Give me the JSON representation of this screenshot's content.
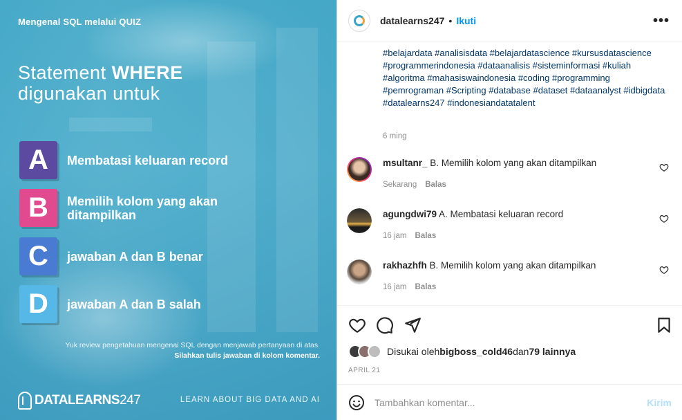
{
  "post_image": {
    "header": "Mengenal SQL melalui QUIZ",
    "question_line1_pre": "Statement ",
    "question_line1_bold": "WHERE",
    "question_line2": "digunakan untuk",
    "options": [
      {
        "letter": "A",
        "text": "Membatasi keluaran record",
        "color": "#5b4a9f"
      },
      {
        "letter": "B",
        "text": "Memilih kolom yang akan ditampilkan",
        "color": "#e24a8f"
      },
      {
        "letter": "C",
        "text": "jawaban A dan B benar",
        "color": "#4a7bd3"
      },
      {
        "letter": "D",
        "text": "jawaban A dan B salah",
        "color": "#55b8e6"
      }
    ],
    "footer_line1": "Yuk review pengetahuan mengenai SQL dengan menjawab pertanyaan di atas.",
    "footer_line2": "Silahkan tulis jawaban di kolom komentar.",
    "brand_bold": "DATA",
    "brand_mid": "LEARNS",
    "brand_num": "247",
    "tagline": "LEARN ABOUT BIG DATA AND AI"
  },
  "panel": {
    "username": "datalearns247",
    "dot": "•",
    "follow": "Ikuti",
    "more": "•••",
    "hashtags": "#belajardata #analisisdata #belajardatascience #kursusdatascience #programmerindonesia #dataanalisis #sisteminformasi #kuliah #algoritma #mahasiswaindonesia #coding #programming #pemrograman #Scripting #database #dataset #dataanalyst #idbigdata #datalearns247 #indonesiandatatalent",
    "post_time": "6 ming",
    "comments": [
      {
        "user": "msultanr_",
        "text": "B. Memilih kolom yang akan ditampilkan",
        "time": "Sekarang",
        "reply": "Balas"
      },
      {
        "user": "agungdwi79",
        "text": "A. Membatasi keluaran record",
        "time": "16 jam",
        "reply": "Balas"
      },
      {
        "user": "rakhazhfh",
        "text": "B. Memilih kolom yang akan ditampilkan",
        "time": "16 jam",
        "reply": "Balas"
      }
    ],
    "likes_prefix": "Disukai oleh ",
    "likes_user": "bigboss_cold46",
    "likes_mid": " dan ",
    "likes_count": "79 lainnya",
    "date": "APRIL 21",
    "comment_placeholder": "Tambahkan komentar...",
    "post_button": "Kirim"
  },
  "colors": {
    "accent": "#0095f6",
    "hashtag": "#00376b",
    "muted": "#8e8e8e"
  }
}
